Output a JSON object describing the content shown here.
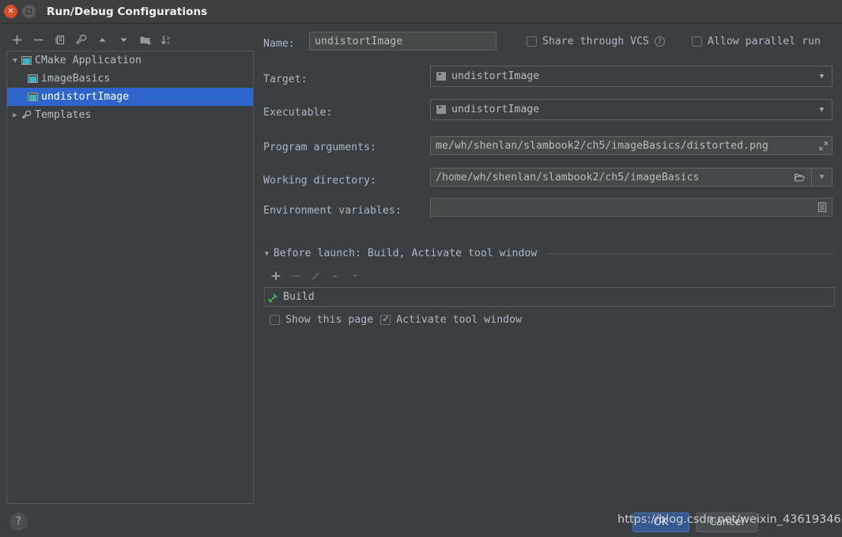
{
  "window": {
    "title": "Run/Debug Configurations",
    "close_icon": "close-icon",
    "maximize_icon": "maximize-icon"
  },
  "tree_toolbar": {
    "items": [
      {
        "icon": "plus-icon",
        "label": "Add New Configuration"
      },
      {
        "icon": "minus-icon",
        "label": "Remove Configuration"
      },
      {
        "icon": "copy-icon",
        "label": "Copy Configuration"
      },
      {
        "icon": "wrench-icon",
        "label": "Edit Configuration Templates"
      },
      {
        "icon": "arrow-up-icon",
        "label": "Move Up"
      },
      {
        "icon": "arrow-down-icon",
        "label": "Move Down"
      },
      {
        "icon": "folder-add-icon",
        "label": "Move into New Folder"
      },
      {
        "icon": "sort-az-icon",
        "label": "Sort Configurations"
      }
    ]
  },
  "tree": {
    "nodes": [
      {
        "label": "CMake Application",
        "icon": "configuration-icon",
        "twisty": "▼",
        "level": 0,
        "selected": false
      },
      {
        "label": "imageBasics",
        "icon": "configuration-icon",
        "twisty": "",
        "level": 1,
        "selected": false
      },
      {
        "label": "undistortImage",
        "icon": "configuration-icon",
        "twisty": "",
        "level": 1,
        "selected": true
      },
      {
        "label": "Templates",
        "icon": "wrench-icon",
        "twisty": "▶",
        "level": 0,
        "selected": false
      }
    ]
  },
  "form": {
    "name_label": "Name:",
    "name_value": "undistortImage",
    "share_vcs_label": "Share through VCS",
    "share_vcs_checked": false,
    "share_help_icon": "help-icon",
    "allow_parallel_label": "Allow parallel run",
    "allow_parallel_checked": false,
    "target_label": "Target:",
    "target_value": "undistortImage",
    "target_icon": "executable-icon",
    "executable_label": "Executable:",
    "executable_value": "undistortImage",
    "executable_icon": "executable-icon",
    "program_args_label": "Program arguments:",
    "program_args_value": "me/wh/shenlan/slambook2/ch5/imageBasics/distorted.png",
    "program_args_expand_icon": "expand-icon",
    "working_dir_label": "Working directory:",
    "working_dir_value": "/home/wh/shenlan/slambook2/ch5/imageBasics",
    "working_dir_browse_icon": "folder-icon",
    "working_dir_dropdown_icon": "chevron-down-icon",
    "env_vars_label": "Environment variables:",
    "env_vars_value": "",
    "env_vars_browse_icon": "list-icon"
  },
  "before_launch": {
    "header": "Before launch: Build, Activate tool window",
    "twisty": "▼",
    "toolbar": [
      {
        "icon": "plus-icon",
        "label": "Add",
        "disabled": false
      },
      {
        "icon": "minus-icon",
        "label": "Remove",
        "disabled": true
      },
      {
        "icon": "pencil-icon",
        "label": "Edit",
        "disabled": true
      },
      {
        "icon": "arrow-up-icon",
        "label": "Move Up",
        "disabled": true
      },
      {
        "icon": "arrow-down-icon",
        "label": "Move Down",
        "disabled": true
      }
    ],
    "tasks": [
      {
        "name": "Build",
        "icon": "build-hammer-icon"
      }
    ],
    "show_page_label": "Show this page",
    "show_page_checked": false,
    "activate_tool_window_label": "Activate tool window",
    "activate_tool_window_checked": true
  },
  "footer": {
    "help_label": "?",
    "ok_label": "OK",
    "cancel_label": "Cancel",
    "watermark": "https://blog.csdn.net/weixin_43619346"
  },
  "colors": {
    "background": "#3c3f41",
    "selection": "#2f65cb",
    "label_text": "#a9b7c6",
    "value_text": "#bbbbbb",
    "field_bg": "#45494a",
    "border": "#55585a",
    "accent_green": "#4ea85a",
    "accent_teal": "#35b8c4",
    "close_button": "#d8502a",
    "ok_button": "#36598f"
  }
}
